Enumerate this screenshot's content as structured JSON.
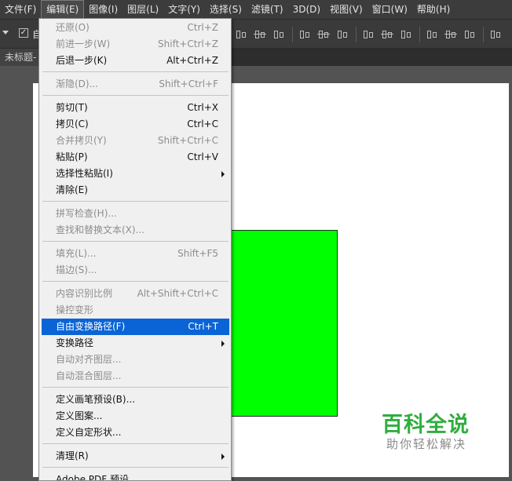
{
  "menubar": {
    "items": [
      "文件(F)",
      "编辑(E)",
      "图像(I)",
      "图层(L)",
      "文字(Y)",
      "选择(S)",
      "滤镜(T)",
      "3D(D)",
      "视图(V)",
      "窗口(W)",
      "帮助(H)"
    ]
  },
  "options": {
    "auto_select_label": "自"
  },
  "document": {
    "tab_label": "未标题-"
  },
  "canvas": {
    "shape_color": "#00ff00"
  },
  "edit_menu": {
    "items": [
      {
        "label": "还原(O)",
        "shortcut": "Ctrl+Z",
        "enabled": false
      },
      {
        "label": "前进一步(W)",
        "shortcut": "Shift+Ctrl+Z",
        "enabled": false
      },
      {
        "label": "后退一步(K)",
        "shortcut": "Alt+Ctrl+Z",
        "enabled": true
      },
      {
        "label": "渐隐(D)...",
        "shortcut": "Shift+Ctrl+F",
        "enabled": false
      },
      {
        "label": "剪切(T)",
        "shortcut": "Ctrl+X",
        "enabled": true
      },
      {
        "label": "拷贝(C)",
        "shortcut": "Ctrl+C",
        "enabled": true
      },
      {
        "label": "合并拷贝(Y)",
        "shortcut": "Shift+Ctrl+C",
        "enabled": false
      },
      {
        "label": "粘贴(P)",
        "shortcut": "Ctrl+V",
        "enabled": true
      },
      {
        "label": "选择性粘贴(I)",
        "shortcut": "",
        "enabled": true,
        "submenu": true
      },
      {
        "label": "清除(E)",
        "shortcut": "",
        "enabled": true
      },
      {
        "label": "拼写检查(H)...",
        "shortcut": "",
        "enabled": false
      },
      {
        "label": "查找和替换文本(X)...",
        "shortcut": "",
        "enabled": false
      },
      {
        "label": "填充(L)...",
        "shortcut": "Shift+F5",
        "enabled": false
      },
      {
        "label": "描边(S)...",
        "shortcut": "",
        "enabled": false
      },
      {
        "label": "内容识别比例",
        "shortcut": "Alt+Shift+Ctrl+C",
        "enabled": false
      },
      {
        "label": "操控变形",
        "shortcut": "",
        "enabled": false
      },
      {
        "label": "自由变换路径(F)",
        "shortcut": "Ctrl+T",
        "enabled": true,
        "highlighted": true
      },
      {
        "label": "变换路径",
        "shortcut": "",
        "enabled": true,
        "submenu": true
      },
      {
        "label": "自动对齐图层...",
        "shortcut": "",
        "enabled": false
      },
      {
        "label": "自动混合图层...",
        "shortcut": "",
        "enabled": false
      },
      {
        "label": "定义画笔预设(B)...",
        "shortcut": "",
        "enabled": true
      },
      {
        "label": "定义图案...",
        "shortcut": "",
        "enabled": true
      },
      {
        "label": "定义自定形状...",
        "shortcut": "",
        "enabled": true
      },
      {
        "label": "清理(R)",
        "shortcut": "",
        "enabled": true,
        "submenu": true
      },
      {
        "label": "Adobe PDF 预设...",
        "shortcut": "",
        "enabled": true
      }
    ]
  },
  "watermark": {
    "title": "百科全说",
    "subtitle": "助你轻松解决"
  }
}
